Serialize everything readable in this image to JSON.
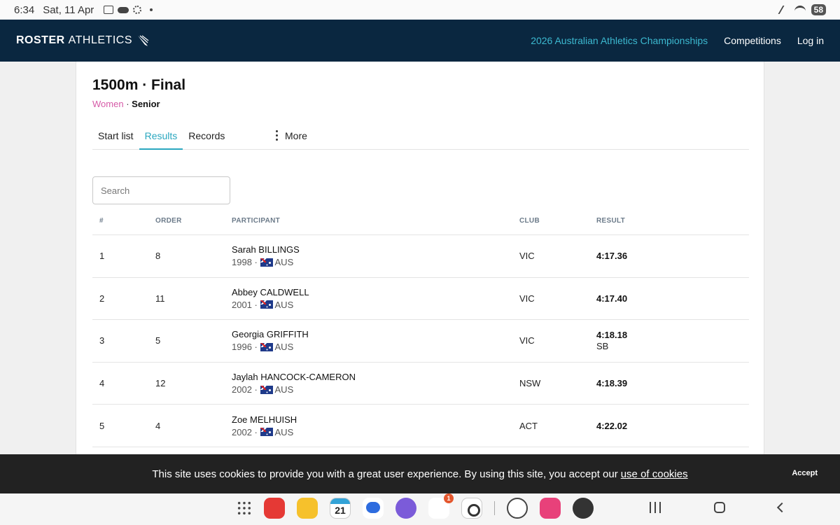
{
  "status_bar": {
    "time": "6:34",
    "date": "Sat, 11 Apr",
    "battery": "58"
  },
  "header": {
    "brand_bold": "ROSTER",
    "brand_light": "ATHLETICS",
    "nav": {
      "championship": "2026 Australian Athletics Championships",
      "competitions": "Competitions",
      "login": "Log in"
    }
  },
  "event": {
    "title": "1500m · Final",
    "gender": "Women",
    "separator": "·",
    "age_group": "Senior"
  },
  "tabs": {
    "start_list": "Start list",
    "results": "Results",
    "records": "Records",
    "more": "More"
  },
  "search": {
    "placeholder": "Search",
    "value": ""
  },
  "table": {
    "headers": {
      "rank": "#",
      "order": "ORDER",
      "participant": "PARTICIPANT",
      "club": "CLUB",
      "result": "RESULT"
    },
    "rows": [
      {
        "rank": "1",
        "order": "8",
        "name": "Sarah BILLINGS",
        "year": "1998",
        "country": "AUS",
        "club": "VIC",
        "result": "4:17.36",
        "note": ""
      },
      {
        "rank": "2",
        "order": "11",
        "name": "Abbey CALDWELL",
        "year": "2001",
        "country": "AUS",
        "club": "VIC",
        "result": "4:17.40",
        "note": ""
      },
      {
        "rank": "3",
        "order": "5",
        "name": "Georgia GRIFFITH",
        "year": "1996",
        "country": "AUS",
        "club": "VIC",
        "result": "4:18.18",
        "note": "SB"
      },
      {
        "rank": "4",
        "order": "12",
        "name": "Jaylah HANCOCK-CAMERON",
        "year": "2002",
        "country": "AUS",
        "club": "NSW",
        "result": "4:18.39",
        "note": ""
      },
      {
        "rank": "5",
        "order": "4",
        "name": "Zoe MELHUISH",
        "year": "2002",
        "country": "AUS",
        "club": "ACT",
        "result": "4:22.02",
        "note": ""
      }
    ],
    "meta_separator": "·"
  },
  "cookie": {
    "text": "This site uses cookies to provide you with a great user experience. By using this site, you accept our",
    "link": "use of cookies",
    "accept": "Accept"
  },
  "dock": {
    "calendar_day": "SAT",
    "calendar_date": "21",
    "badge_count": "1"
  },
  "colors": {
    "header_bg": "#0a2740",
    "accent": "#2aa7bf",
    "gender": "#d65ba8",
    "cookie_bg": "#222222"
  }
}
